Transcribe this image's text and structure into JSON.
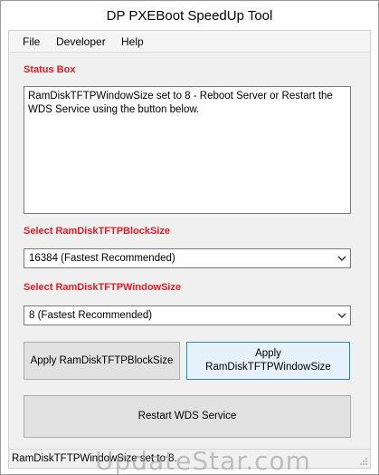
{
  "window": {
    "title": "DP PXEBoot SpeedUp Tool"
  },
  "menu": {
    "items": [
      "File",
      "Developer",
      "Help"
    ]
  },
  "status_box": {
    "label": "Status Box",
    "text": "RamDiskTFTPWindowSize set to 8 - Reboot Server or Restart the WDS Service using the button below."
  },
  "block_size": {
    "label": "Select RamDiskTFTPBlockSize",
    "selected": "16384 (Fastest Recommended)"
  },
  "window_size": {
    "label": "Select RamDiskTFTPWindowSize",
    "selected": "8 (Fastest Recommended)"
  },
  "buttons": {
    "apply_block": "Apply RamDiskTFTPBlockSize",
    "apply_window_line1": "Apply",
    "apply_window_line2": "RamDiskTFTPWindowSize",
    "restart": "Restart WDS Service"
  },
  "statusbar": {
    "text": "RamDiskTFTPWindowSize set to 8."
  },
  "watermark": {
    "text": "UpdateStar.com"
  },
  "colors": {
    "label_red": "#e31e24",
    "default_button_border": "#3c7fb1"
  }
}
